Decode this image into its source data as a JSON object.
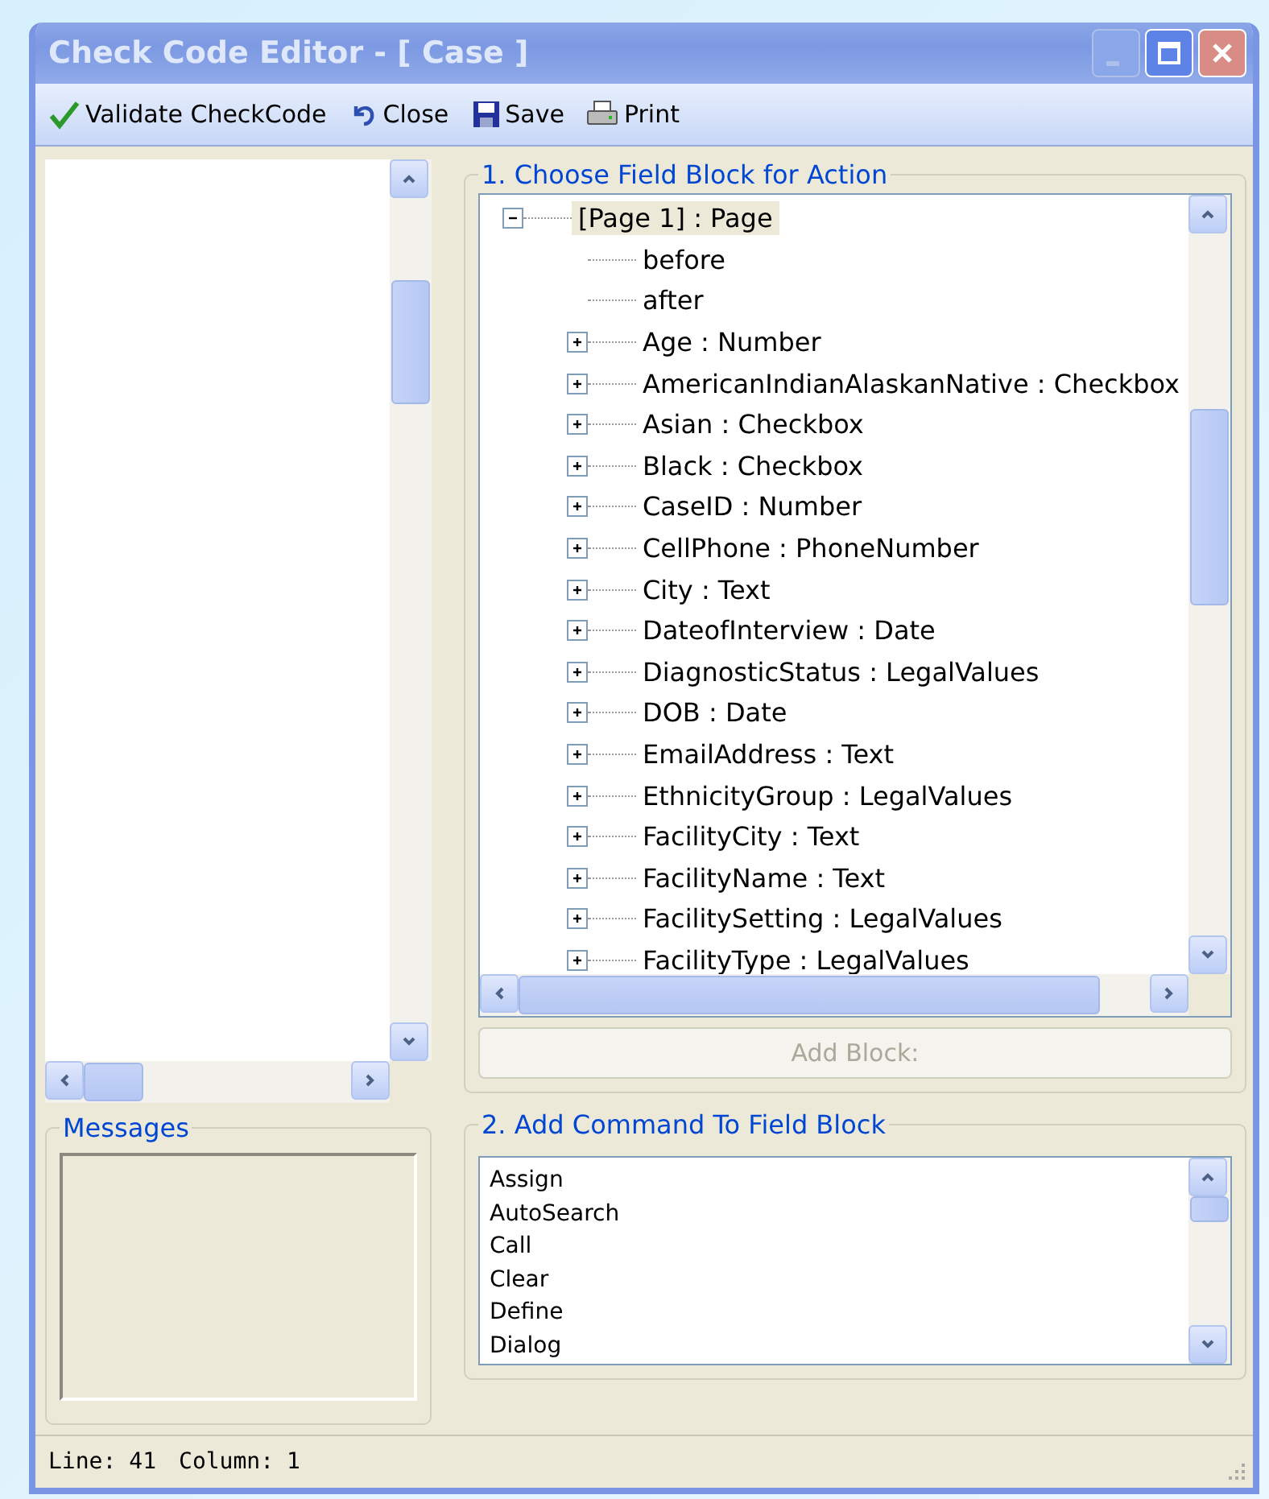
{
  "window": {
    "title": "Check Code Editor - [ Case ]"
  },
  "toolbar": [
    {
      "label": "Validate CheckCode",
      "kind": "validate"
    },
    {
      "label": "Close",
      "kind": "undo"
    },
    {
      "label": "Save",
      "kind": "save"
    },
    {
      "label": "Print",
      "kind": "print"
    }
  ],
  "field_blocks": {
    "title": "1. Choose Field Block for Action",
    "tree": [
      {
        "label": "[Page 1] : Page",
        "kind": "page",
        "expanded": true,
        "selected": true,
        "children": [
          {
            "label": "before",
            "kind": "event"
          },
          {
            "label": "after",
            "kind": "event"
          },
          {
            "label": "Age : Number",
            "kind": "field",
            "expanded": false
          },
          {
            "label": "AmericanIndianAlaskanNative : Checkbox",
            "kind": "field",
            "expanded": false
          },
          {
            "label": "Asian : Checkbox",
            "kind": "field",
            "expanded": false
          },
          {
            "label": "Black : Checkbox",
            "kind": "field",
            "expanded": false
          },
          {
            "label": "CaseID : Number",
            "kind": "field",
            "expanded": false
          },
          {
            "label": "CellPhone : PhoneNumber",
            "kind": "field",
            "expanded": false
          },
          {
            "label": "City : Text",
            "kind": "field",
            "expanded": false
          },
          {
            "label": "DateofInterview : Date",
            "kind": "field",
            "expanded": false
          },
          {
            "label": "DiagnosticStatus : LegalValues",
            "kind": "field",
            "expanded": false
          },
          {
            "label": "DOB : Date",
            "kind": "field",
            "expanded": false
          },
          {
            "label": "EmailAddress : Text",
            "kind": "field",
            "expanded": false
          },
          {
            "label": "EthnicityGroup : LegalValues",
            "kind": "field",
            "expanded": false
          },
          {
            "label": "FacilityCity : Text",
            "kind": "field",
            "expanded": false
          },
          {
            "label": "FacilityName : Text",
            "kind": "field",
            "expanded": false
          },
          {
            "label": "FacilitySetting : LegalValues",
            "kind": "field",
            "expanded": false
          },
          {
            "label": "FacilityType : LegalValues",
            "kind": "field",
            "expanded": false
          }
        ]
      }
    ],
    "add_button": {
      "label": "Add Block:",
      "disabled": true
    }
  },
  "messages": {
    "title": "Messages"
  },
  "commands": {
    "title": "2. Add Command To Field Block",
    "items": [
      "Assign",
      "AutoSearch",
      "Call",
      "Clear",
      "Define",
      "Dialog"
    ]
  },
  "status_bar": {
    "line_label": "Line:",
    "line": "41",
    "column_label": "Column:",
    "column": "1"
  }
}
